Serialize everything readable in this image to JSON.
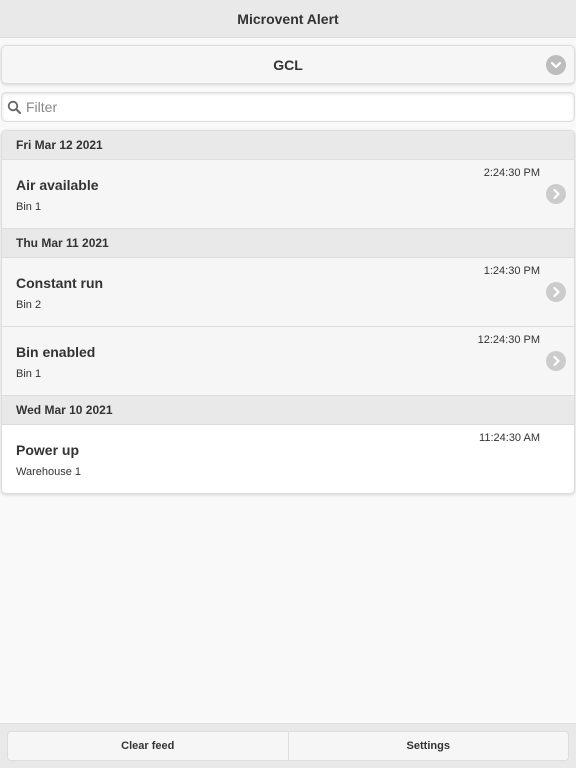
{
  "header": {
    "title": "Microvent Alert"
  },
  "site_select": {
    "value": "GCL",
    "icon": "chevron-down-icon"
  },
  "filter": {
    "placeholder": "Filter",
    "value": "",
    "icon": "search-icon"
  },
  "feed": {
    "groups": [
      {
        "date": "Fri Mar 12 2021",
        "items": [
          {
            "title": "Air available",
            "subtitle": "Bin 1",
            "time": "2:24:30 PM",
            "has_arrow": true
          }
        ]
      },
      {
        "date": "Thu Mar 11 2021",
        "items": [
          {
            "title": "Constant run",
            "subtitle": "Bin 2",
            "time": "1:24:30 PM",
            "has_arrow": true
          },
          {
            "title": "Bin enabled",
            "subtitle": "Bin 1",
            "time": "12:24:30 PM",
            "has_arrow": true
          }
        ]
      },
      {
        "date": "Wed Mar 10 2021",
        "items": [
          {
            "title": "Power up",
            "subtitle": "Warehouse 1",
            "time": "11:24:30 AM",
            "has_arrow": false
          }
        ]
      }
    ]
  },
  "footer": {
    "clear_label": "Clear feed",
    "settings_label": "Settings"
  },
  "colors": {
    "header_bg": "#e9e9e9",
    "list_item_bg": "#f6f6f6",
    "arrow_bg": "#cccccc",
    "text": "#333333"
  }
}
